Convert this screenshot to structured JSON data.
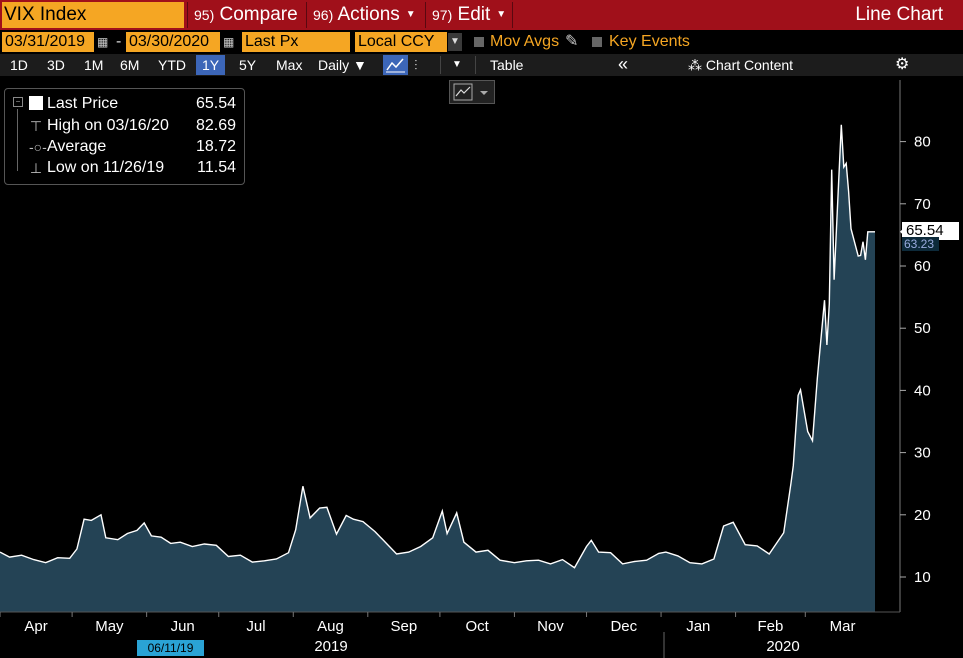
{
  "titlebar": {
    "ticker": "VIX Index",
    "compare_num": "95)",
    "compare_label": "Compare",
    "actions_num": "96)",
    "actions_label": "Actions",
    "edit_num": "97)",
    "edit_label": "Edit",
    "view_label": "Line Chart"
  },
  "params": {
    "start_date": "03/31/2019",
    "dash": "-",
    "end_date": "03/30/2020",
    "field": "Last Px",
    "currency": "Local CCY",
    "mov_avgs": "Mov Avgs",
    "key_events": "Key Events"
  },
  "toolbar": {
    "ranges": [
      "1D",
      "3D",
      "1M",
      "6M",
      "YTD",
      "1Y",
      "5Y",
      "Max"
    ],
    "active_range": "1Y",
    "frequency": "Daily ▼",
    "table": "Table",
    "collapse": "«",
    "chart_content": "Chart Content",
    "settings_icon": "gear-icon"
  },
  "legend": {
    "last_label": "Last Price",
    "last_value": "65.54",
    "high_label": "High on 03/16/20",
    "high_value": "82.69",
    "avg_label": "Average",
    "avg_value": "18.72",
    "low_label": "Low on 11/26/19",
    "low_value": "11.54"
  },
  "badges": {
    "last": "65.54",
    "secondary": "63.23"
  },
  "cursor_date": "06/11/19",
  "colors": {
    "title_bg": "#a0101a",
    "field_bg": "#f5a623",
    "area_fill": "#244355",
    "line": "#ffffff",
    "active": "#3c66b8"
  },
  "chart_data": {
    "type": "area",
    "title": "",
    "xlabel": "",
    "ylabel": "",
    "ylim": [
      5,
      88
    ],
    "yticks": [
      10,
      20,
      30,
      40,
      50,
      60,
      70,
      80
    ],
    "months": [
      "Apr",
      "May",
      "Jun",
      "Jul",
      "Aug",
      "Sep",
      "Oct",
      "Nov",
      "Dec",
      "Jan",
      "Feb",
      "Mar"
    ],
    "years": [
      "2019",
      "2020"
    ],
    "grid": false,
    "series": [
      {
        "name": "Last Price",
        "x": [
          "2019-04-01",
          "2019-04-05",
          "2019-04-10",
          "2019-04-15",
          "2019-04-20",
          "2019-04-25",
          "2019-04-30",
          "2019-05-03",
          "2019-05-06",
          "2019-05-09",
          "2019-05-13",
          "2019-05-15",
          "2019-05-20",
          "2019-05-24",
          "2019-05-28",
          "2019-05-31",
          "2019-06-03",
          "2019-06-07",
          "2019-06-11",
          "2019-06-15",
          "2019-06-20",
          "2019-06-25",
          "2019-06-30",
          "2019-07-05",
          "2019-07-10",
          "2019-07-15",
          "2019-07-20",
          "2019-07-25",
          "2019-07-30",
          "2019-08-02",
          "2019-08-05",
          "2019-08-08",
          "2019-08-12",
          "2019-08-15",
          "2019-08-19",
          "2019-08-23",
          "2019-08-26",
          "2019-08-30",
          "2019-09-04",
          "2019-09-09",
          "2019-09-13",
          "2019-09-18",
          "2019-09-23",
          "2019-09-28",
          "2019-10-02",
          "2019-10-04",
          "2019-10-08",
          "2019-10-11",
          "2019-10-16",
          "2019-10-21",
          "2019-10-26",
          "2019-11-01",
          "2019-11-06",
          "2019-11-11",
          "2019-11-16",
          "2019-11-21",
          "2019-11-26",
          "2019-12-01",
          "2019-12-03",
          "2019-12-06",
          "2019-12-11",
          "2019-12-16",
          "2019-12-21",
          "2019-12-26",
          "2019-12-31",
          "2020-01-03",
          "2020-01-08",
          "2020-01-13",
          "2020-01-18",
          "2020-01-23",
          "2020-01-27",
          "2020-01-31",
          "2020-02-05",
          "2020-02-10",
          "2020-02-15",
          "2020-02-21",
          "2020-02-24",
          "2020-02-25",
          "2020-02-27",
          "2020-02-28",
          "2020-03-02",
          "2020-03-04",
          "2020-03-06",
          "2020-03-09",
          "2020-03-10",
          "2020-03-11",
          "2020-03-12",
          "2020-03-13",
          "2020-03-16",
          "2020-03-17",
          "2020-03-18",
          "2020-03-19",
          "2020-03-20",
          "2020-03-23",
          "2020-03-24",
          "2020-03-25",
          "2020-03-26",
          "2020-03-27",
          "2020-03-30"
        ],
        "values": [
          14.0,
          13.2,
          13.5,
          12.8,
          12.3,
          13.1,
          13.0,
          14.5,
          19.3,
          19.1,
          20.0,
          16.3,
          16.0,
          17.0,
          17.5,
          18.7,
          16.6,
          16.4,
          15.4,
          15.6,
          14.9,
          15.3,
          15.1,
          13.3,
          13.5,
          12.4,
          12.6,
          12.9,
          13.9,
          17.6,
          24.6,
          19.5,
          21.1,
          21.2,
          16.9,
          19.9,
          19.3,
          18.9,
          17.3,
          15.3,
          13.7,
          14.0,
          14.9,
          16.3,
          20.6,
          17.0,
          20.3,
          15.6,
          14.0,
          14.3,
          12.7,
          12.3,
          12.6,
          12.7,
          12.1,
          12.8,
          11.5,
          14.9,
          15.9,
          14.0,
          13.9,
          12.1,
          12.5,
          12.7,
          13.8,
          14.0,
          13.4,
          12.3,
          12.1,
          12.9,
          18.2,
          18.8,
          15.2,
          15.0,
          13.7,
          17.1,
          25.0,
          27.9,
          39.2,
          40.1,
          33.4,
          31.9,
          41.9,
          54.5,
          47.3,
          53.9,
          75.5,
          57.8,
          82.7,
          75.9,
          76.5,
          72.0,
          66.0,
          61.6,
          61.7,
          63.9,
          61.0,
          65.5,
          65.5
        ]
      }
    ]
  }
}
